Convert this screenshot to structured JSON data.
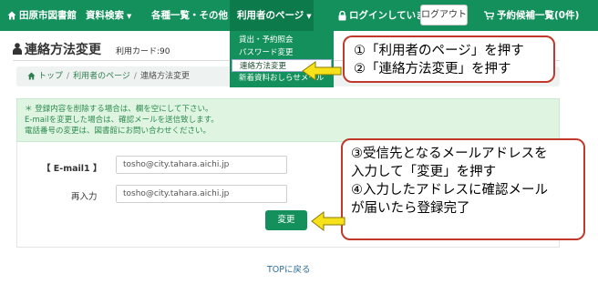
{
  "nav": {
    "home_label": "田原市図書館",
    "search_label": "資料検索",
    "list_label": "各種一覧・その他",
    "user_page_label": "利用者のページ",
    "login_status": "ログインしています",
    "logout_label": "ログアウト",
    "cart_label": "予約候補一覧(0件)"
  },
  "dropdown": {
    "items": [
      "貸出・予約照会",
      "パスワード変更",
      "連絡方法変更",
      "新着資料おしらせメール"
    ],
    "active_index": 2
  },
  "page": {
    "title": "連絡方法変更",
    "card_label": "利用カード:90"
  },
  "breadcrumb": {
    "items": [
      "トップ",
      "利用者のページ",
      "連絡方法変更"
    ]
  },
  "notice": {
    "lines": [
      "＊ 登録内容を削除する場合は、欄を空にして下さい。",
      "E-mailを変更した場合は、確認メールを送信致します。",
      "電話番号の変更は、図書館にお問い合わせください。"
    ]
  },
  "form": {
    "email_label": "【 E-mail1 】",
    "email_value": "tosho@city.tahara.aichi.jp",
    "reenter_label": "再入力",
    "reenter_value": "tosho@city.tahara.aichi.jp",
    "submit_label": "変更"
  },
  "footer": {
    "top_link": "TOPに戻る"
  },
  "callouts": {
    "first": [
      "①「利用者のページ」を押す",
      "②「連絡方法変更」を押す"
    ],
    "second": [
      "③受信先となるメールアドレスを",
      "入力して「変更」を押す",
      "④入力したアドレスに確認メール",
      "が届いたら登録完了"
    ]
  },
  "colors": {
    "nav_green": "#14905c",
    "notice_bg": "#dff5e2",
    "callout_border": "#c0392b",
    "arrow_yellow": "#f7e11b"
  },
  "icons": [
    "home-icon",
    "lock-icon",
    "cart-icon",
    "person-icon",
    "chevron-down-icon"
  ]
}
